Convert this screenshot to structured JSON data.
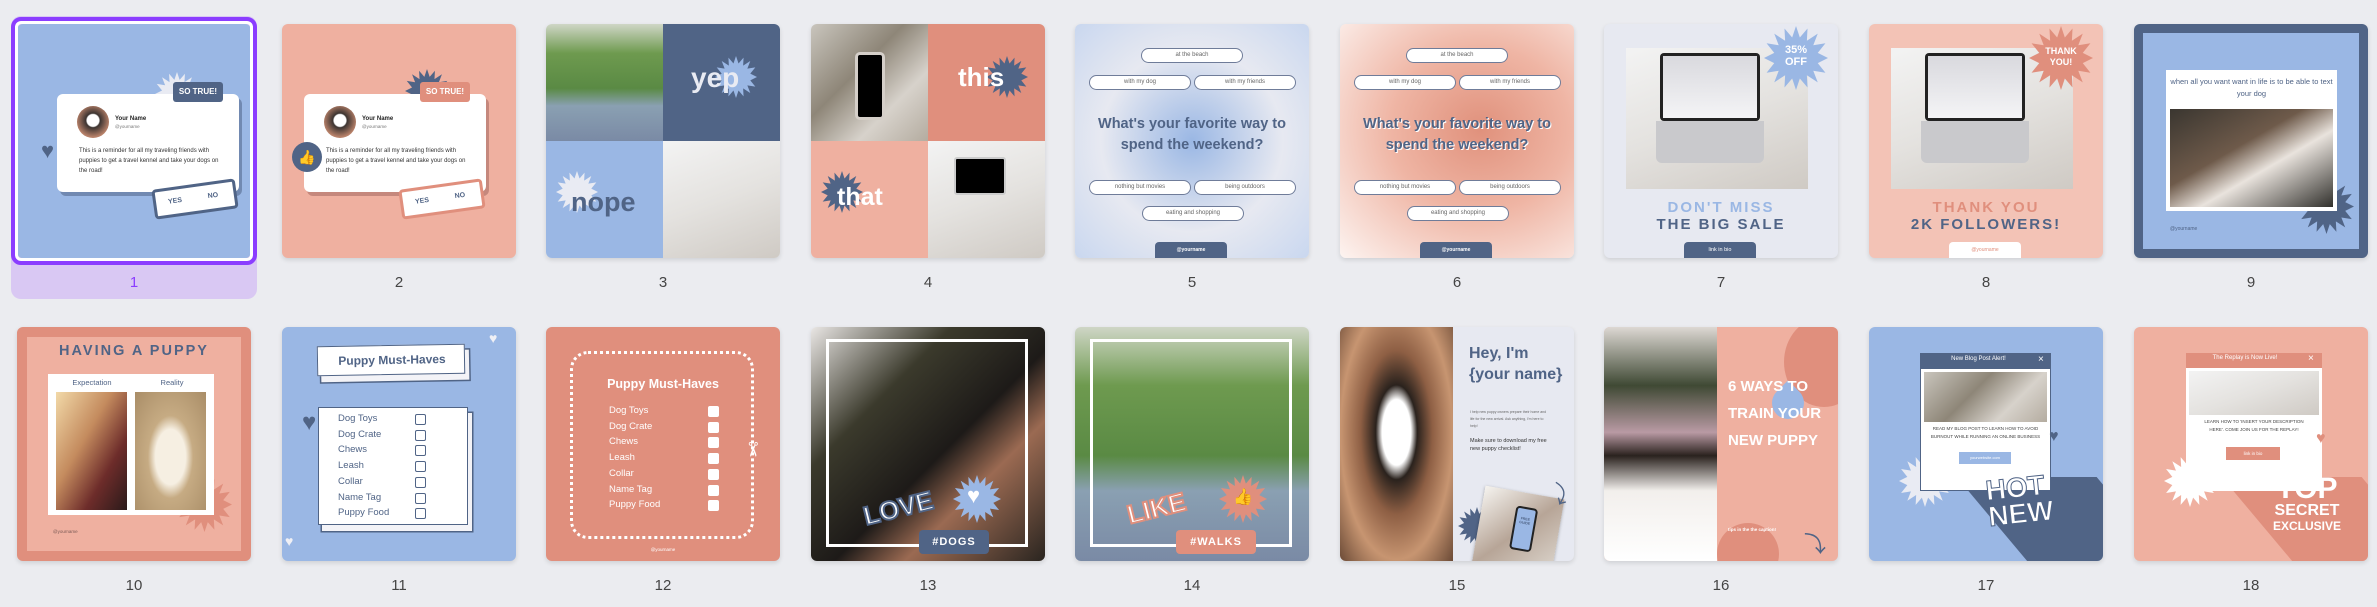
{
  "selected_page": 1,
  "colors": {
    "background": "#ebecf0",
    "selection": "#8b3dff",
    "selection_bg": "#d9c8f3",
    "blue": "#9ab7e4",
    "navy": "#506486",
    "peach": "#efb0a0",
    "salmon": "#e08f7d",
    "grey": "#e7e9f1"
  },
  "pages": [
    {
      "number": "1",
      "badge": "SO TRUE!",
      "name": "Your Name",
      "handle": "@yourname",
      "body": "This is a reminder for all my traveling friends with puppies to get a travel kennel and take your dogs on the road!",
      "yes": "YES",
      "no": "NO",
      "icon": "heart-icon"
    },
    {
      "number": "2",
      "badge": "SO TRUE!",
      "name": "Your Name",
      "handle": "@yourname",
      "body": "This is a reminder for all my traveling friends with puppies to get a travel kennel and take your dogs on the road!",
      "yes": "YES",
      "no": "NO",
      "icon": "thumbs-up-icon"
    },
    {
      "number": "3",
      "words": [
        "yep",
        "nope"
      ]
    },
    {
      "number": "4",
      "words": [
        "this",
        "that"
      ]
    },
    {
      "number": "5",
      "question": "What's your favorite way to spend the weekend?",
      "options": [
        "at the beach",
        "with my dog",
        "with my friends",
        "nothing but movies",
        "being outdoors",
        "eating and shopping"
      ],
      "handle": "@yourname"
    },
    {
      "number": "6",
      "question": "What's your favorite way to spend the weekend?",
      "options": [
        "at the beach",
        "with my dog",
        "with my friends",
        "nothing but movies",
        "being outdoors",
        "eating and shopping"
      ],
      "handle": "@yourname"
    },
    {
      "number": "7",
      "badge_line1": "35%",
      "badge_line2": "OFF",
      "title_line1": "DON'T MISS",
      "title_line2": "THE BIG SALE",
      "button": "link in bio"
    },
    {
      "number": "8",
      "badge_line1": "THANK",
      "badge_line2": "YOU!",
      "title_line1": "THANK YOU",
      "title_line2": "2K FOLLOWERS!",
      "button": "@yourname"
    },
    {
      "number": "9",
      "caption": "when all you want want in life is to be able to text your dog",
      "handle": "@yourname"
    },
    {
      "number": "10",
      "title": "HAVING A PUPPY",
      "left_label": "Expectation",
      "right_label": "Reality",
      "handle": "@yourname"
    },
    {
      "number": "11",
      "title": "Puppy Must-Haves",
      "items": [
        "Dog Toys",
        "Dog Crate",
        "Chews",
        "Leash",
        "Collar",
        "Name Tag",
        "Puppy Food"
      ]
    },
    {
      "number": "12",
      "title": "Puppy Must-Haves",
      "items": [
        "Dog Toys",
        "Dog Crate",
        "Chews",
        "Leash",
        "Collar",
        "Name Tag",
        "Puppy Food"
      ],
      "handle": "@yourname"
    },
    {
      "number": "13",
      "sticker": "LOVE",
      "tag": "#DOGS"
    },
    {
      "number": "14",
      "sticker": "LIKE",
      "tag": "#WALKS"
    },
    {
      "number": "15",
      "title": "Hey, I'm {your name}",
      "body": "I help new puppy owners prepare their home and life for the new arrival. Ask anything, I'm here to help!",
      "cta": "Make sure to download my free new puppy checklist!",
      "phone_text": "FREE GUIDE"
    },
    {
      "number": "16",
      "title": "6 WAYS TO TRAIN YOUR NEW PUPPY",
      "subtitle": "tips in the the caption!"
    },
    {
      "number": "17",
      "popup_title": "New Blog Post Alert!",
      "popup_body": "READ MY BLOG POST TO LEARN HOW TO AVOID BURNOUT WHILE RUNNING AN ONLINE BUSINESS",
      "button": "yourwebsite.com",
      "sticker_line1": "HOT",
      "sticker_line2": "NEW",
      "close": "×"
    },
    {
      "number": "18",
      "popup_title": "The Replay is Now Live!",
      "popup_body": "LEARN HOW TO 'INSERT YOUR DESCRIPTION HERE'. COME JOIN US FOR THE REPLAY!",
      "button": "link in bio",
      "sticker_line1": "TOP",
      "sticker_line2": "SECRET",
      "sticker_line3": "EXCLUSIVE",
      "close": "×"
    }
  ]
}
